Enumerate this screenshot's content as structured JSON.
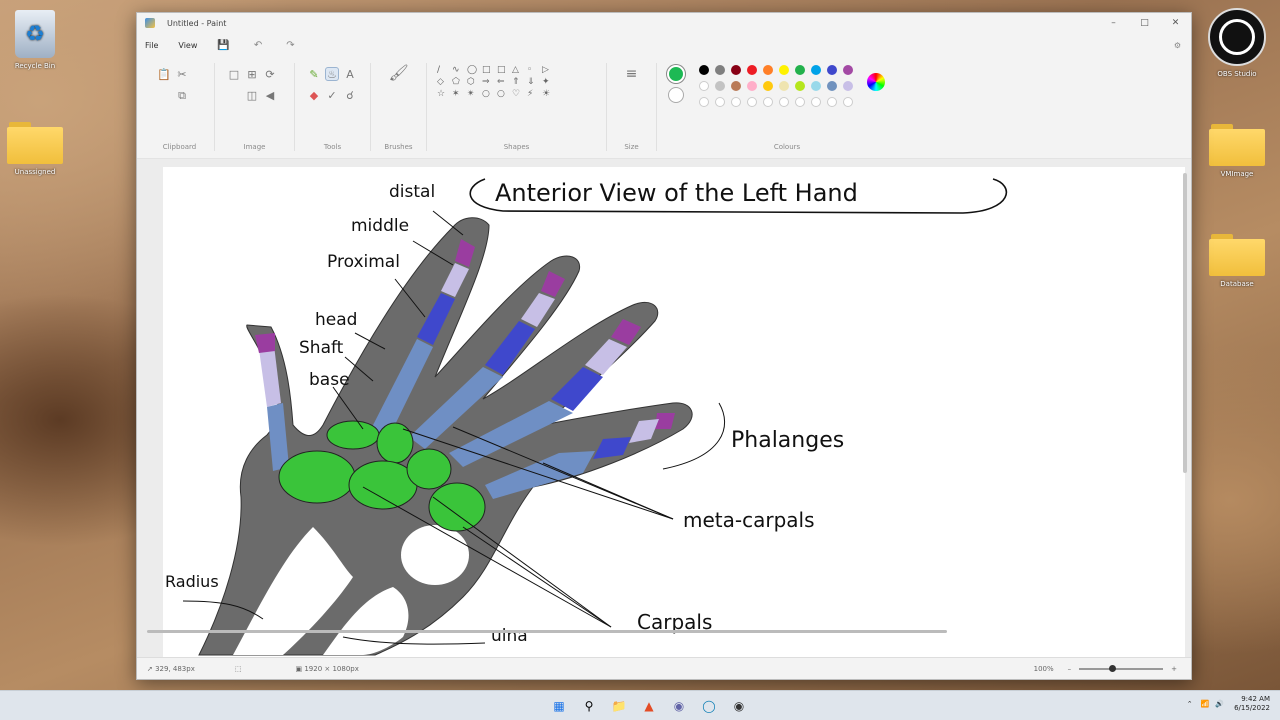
{
  "desktop": {
    "icons": [
      {
        "label": "Recycle Bin"
      },
      {
        "label": "Unassigned"
      },
      {
        "label": "OBS Studio"
      },
      {
        "label": "VMImage"
      },
      {
        "label": "Database"
      }
    ]
  },
  "window": {
    "title": "Untitled - Paint",
    "controls": {
      "minimize": "–",
      "maximize": "□",
      "close": "✕"
    }
  },
  "menu": {
    "file": "File",
    "view": "View"
  },
  "ribbon": {
    "groups": {
      "clipboard": "Clipboard",
      "image": "Image",
      "tools": "Tools",
      "brushes": "Brushes",
      "shapes": "Shapes",
      "size": "Size",
      "colours": "Colours"
    },
    "current_colors": {
      "primary": "#1db954",
      "secondary": "#ffffff"
    },
    "palette": [
      "#000000",
      "#7f7f7f",
      "#880015",
      "#ed1c24",
      "#ff7f27",
      "#fff200",
      "#22b14c",
      "#00a2e8",
      "#3f48cc",
      "#a349a4",
      "#ffffff",
      "#c3c3c3",
      "#b97a57",
      "#ffaec9",
      "#ffc90e",
      "#efe4b0",
      "#b5e61d",
      "#99d9ea",
      "#7092be",
      "#c8bfe7"
    ]
  },
  "drawing": {
    "title": "Anterior View of the Left Hand",
    "labels": {
      "distal": "distal",
      "middle": "middle",
      "proximal": "Proximal",
      "head": "head",
      "shaft": "Shaft",
      "base": "base",
      "phalanges": "Phalanges",
      "metacarpals": "meta-carpals",
      "carpals": "Carpals",
      "radius": "Radius",
      "ulna": "ulna"
    }
  },
  "status": {
    "cursor": "329, 483px",
    "canvas_size": "1920 × 1080px",
    "zoom": "100%"
  },
  "taskbar": {
    "time": "9:42 AM",
    "date": "6/15/2022"
  }
}
